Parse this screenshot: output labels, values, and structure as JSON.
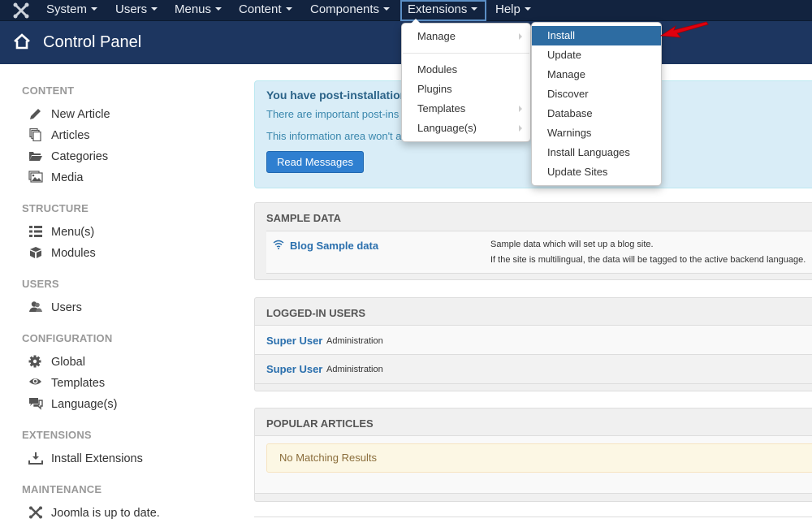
{
  "navbar": {
    "logo_icon": "joomla-logo-icon",
    "items": [
      {
        "label": "System"
      },
      {
        "label": "Users"
      },
      {
        "label": "Menus"
      },
      {
        "label": "Content"
      },
      {
        "label": "Components"
      },
      {
        "label": "Extensions",
        "active": true
      },
      {
        "label": "Help"
      }
    ]
  },
  "header": {
    "icon": "home-icon",
    "title": "Control Panel"
  },
  "extensions_menu": {
    "items": [
      {
        "label": "Manage",
        "has_submenu": true
      },
      {
        "label": "Modules",
        "has_submenu": false
      },
      {
        "label": "Plugins",
        "has_submenu": false
      },
      {
        "label": "Templates",
        "has_submenu": true
      },
      {
        "label": "Language(s)",
        "has_submenu": true
      }
    ]
  },
  "manage_submenu": {
    "items": [
      {
        "label": "Install",
        "highlighted": true
      },
      {
        "label": "Update"
      },
      {
        "label": "Manage"
      },
      {
        "label": "Discover"
      },
      {
        "label": "Database"
      },
      {
        "label": "Warnings"
      },
      {
        "label": "Install Languages"
      },
      {
        "label": "Update Sites"
      }
    ]
  },
  "sidebar": {
    "sections": [
      {
        "heading": "CONTENT",
        "items": [
          {
            "label": "New Article",
            "icon": "pencil-icon"
          },
          {
            "label": "Articles",
            "icon": "stack-icon"
          },
          {
            "label": "Categories",
            "icon": "folder-icon"
          },
          {
            "label": "Media",
            "icon": "image-icon"
          }
        ]
      },
      {
        "heading": "STRUCTURE",
        "items": [
          {
            "label": "Menu(s)",
            "icon": "list-icon"
          },
          {
            "label": "Modules",
            "icon": "cube-icon"
          }
        ]
      },
      {
        "heading": "USERS",
        "items": [
          {
            "label": "Users",
            "icon": "users-icon"
          }
        ]
      },
      {
        "heading": "CONFIGURATION",
        "items": [
          {
            "label": "Global",
            "icon": "cog-icon"
          },
          {
            "label": "Templates",
            "icon": "eye-icon"
          },
          {
            "label": "Language(s)",
            "icon": "comments-icon"
          }
        ]
      },
      {
        "heading": "EXTENSIONS",
        "items": [
          {
            "label": "Install Extensions",
            "icon": "download-icon"
          }
        ]
      },
      {
        "heading": "MAINTENANCE",
        "items": [
          {
            "label": "Joomla is up to date.",
            "icon": "joomla-icon"
          }
        ]
      }
    ]
  },
  "post_install_alert": {
    "title": "You have post-installation",
    "line1": "There are important post-ins",
    "line2": "This information area won't a",
    "button": "Read Messages"
  },
  "sample_data": {
    "heading": "SAMPLE DATA",
    "items": [
      {
        "title": "Blog Sample data",
        "icon": "wifi-icon",
        "desc1": "Sample data which will set up a blog site.",
        "desc2": "If the site is multilingual, the data will be tagged to the active backend language."
      }
    ]
  },
  "logged_in_users": {
    "heading": "LOGGED-IN USERS",
    "rows": [
      {
        "name": "Super User",
        "location": "Administration"
      },
      {
        "name": "Super User",
        "location": "Administration"
      }
    ]
  },
  "popular_articles": {
    "heading": "POPULAR ARTICLES",
    "empty_message": "No Matching Results"
  },
  "colors": {
    "navbar": "#12233f",
    "header": "#1d3660",
    "highlight": "#2d6ca2",
    "primary_button": "#2f7fd0",
    "annotation_arrow": "#e0000e"
  }
}
